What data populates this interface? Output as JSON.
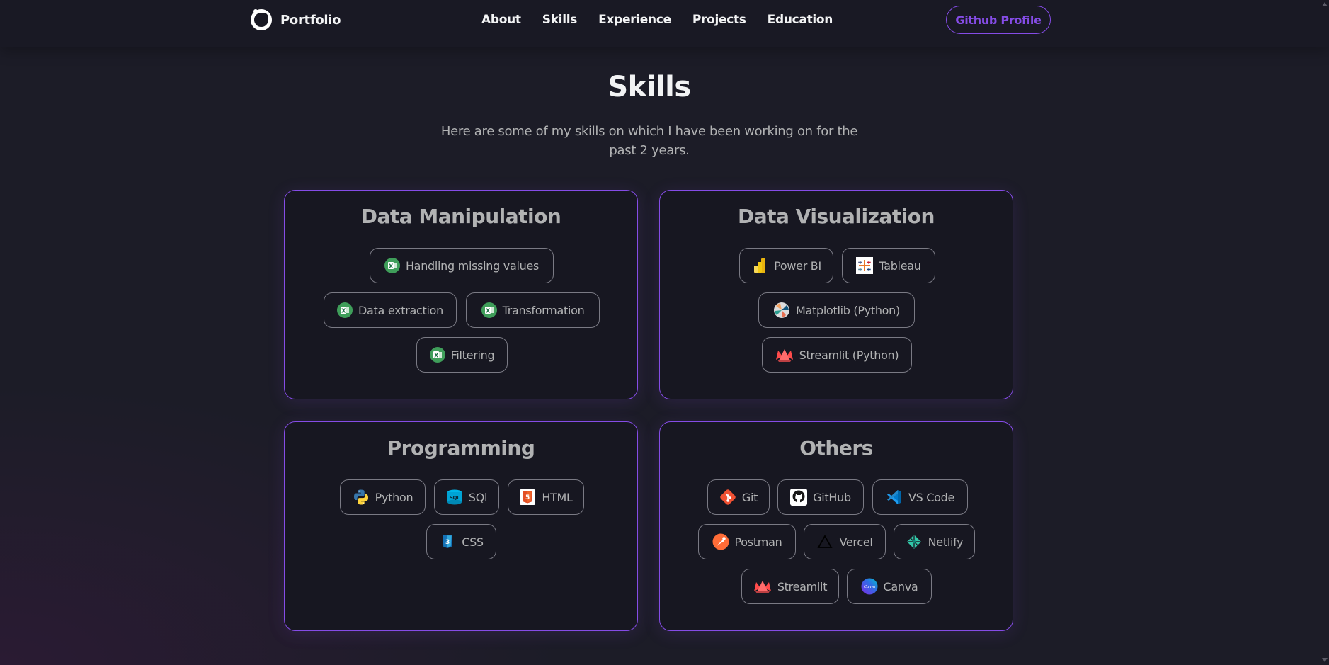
{
  "nav": {
    "logo_text": "Portfolio",
    "links": [
      "About",
      "Skills",
      "Experience",
      "Projects",
      "Education"
    ],
    "github_button": "Github Profile"
  },
  "skills": {
    "title": "Skills",
    "description_line1": "Here are some of my skills on which I have been working on for the",
    "description_line2": "past 2 years."
  },
  "categories": [
    {
      "title": "Data Manipulation",
      "items": [
        {
          "label": "Handling missing values",
          "icon": "excel-icon"
        },
        {
          "label": "Data extraction",
          "icon": "excel-icon"
        },
        {
          "label": "Transformation",
          "icon": "excel-icon"
        },
        {
          "label": "Filtering",
          "icon": "excel-icon"
        }
      ]
    },
    {
      "title": "Data Visualization",
      "items": [
        {
          "label": "Power BI",
          "icon": "powerbi-icon"
        },
        {
          "label": "Tableau",
          "icon": "tableau-icon"
        },
        {
          "label": "Matplotlib (Python)",
          "icon": "matplotlib-icon"
        },
        {
          "label": "Streamlit (Python)",
          "icon": "streamlit-icon"
        }
      ]
    },
    {
      "title": "Programming",
      "items": [
        {
          "label": "Python",
          "icon": "python-icon"
        },
        {
          "label": "SQl",
          "icon": "sql-icon"
        },
        {
          "label": "HTML",
          "icon": "html5-icon"
        },
        {
          "label": "CSS",
          "icon": "css3-icon"
        }
      ]
    },
    {
      "title": "Others",
      "items": [
        {
          "label": "Git",
          "icon": "git-icon"
        },
        {
          "label": "GitHub",
          "icon": "github-icon"
        },
        {
          "label": "VS Code",
          "icon": "vscode-icon"
        },
        {
          "label": "Postman",
          "icon": "postman-icon"
        },
        {
          "label": "Vercel",
          "icon": "vercel-icon"
        },
        {
          "label": "Netlify",
          "icon": "netlify-icon"
        },
        {
          "label": "Streamlit",
          "icon": "streamlit-icon"
        },
        {
          "label": "Canva",
          "icon": "canva-icon",
          "icon_text": "Canva"
        }
      ]
    }
  ],
  "colors": {
    "background": "#1c1c27",
    "card_background": "#171721",
    "accent": "#854ce6",
    "text_primary": "#f2f3f4",
    "text_secondary": "#b1b2b3"
  }
}
